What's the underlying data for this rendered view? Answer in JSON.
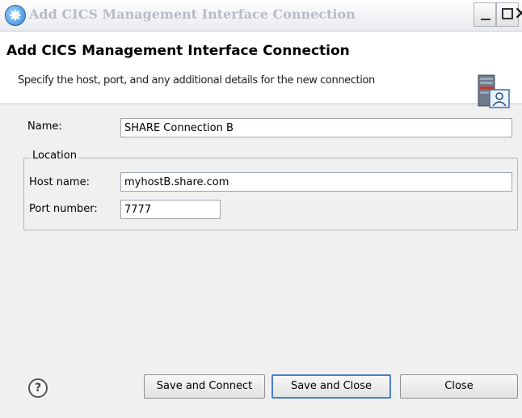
{
  "window": {
    "title": "Add CICS Management Interface Connection",
    "close_glyph": "✕",
    "app_icon": "sun-icon"
  },
  "banner": {
    "title": "Add CICS Management Interface Connection",
    "description": "Specify the host, port, and any additional details for the new connection",
    "graphic": "server-user-icon"
  },
  "form": {
    "name_label": "Name:",
    "name_value": "SHARE Connection B",
    "location_group_label": "Location",
    "host_label": "Host name:",
    "host_value": "myhostB.share.com",
    "port_label": "Port number:",
    "port_value": "7777"
  },
  "buttons": {
    "help_glyph": "?",
    "save_connect": "Save and Connect",
    "save_close": "Save and Close",
    "close": "Close"
  },
  "colors": {
    "title_text": "#b7bcc4",
    "default_button_border": "#4a7fc9",
    "background": "#f0f0f0"
  }
}
